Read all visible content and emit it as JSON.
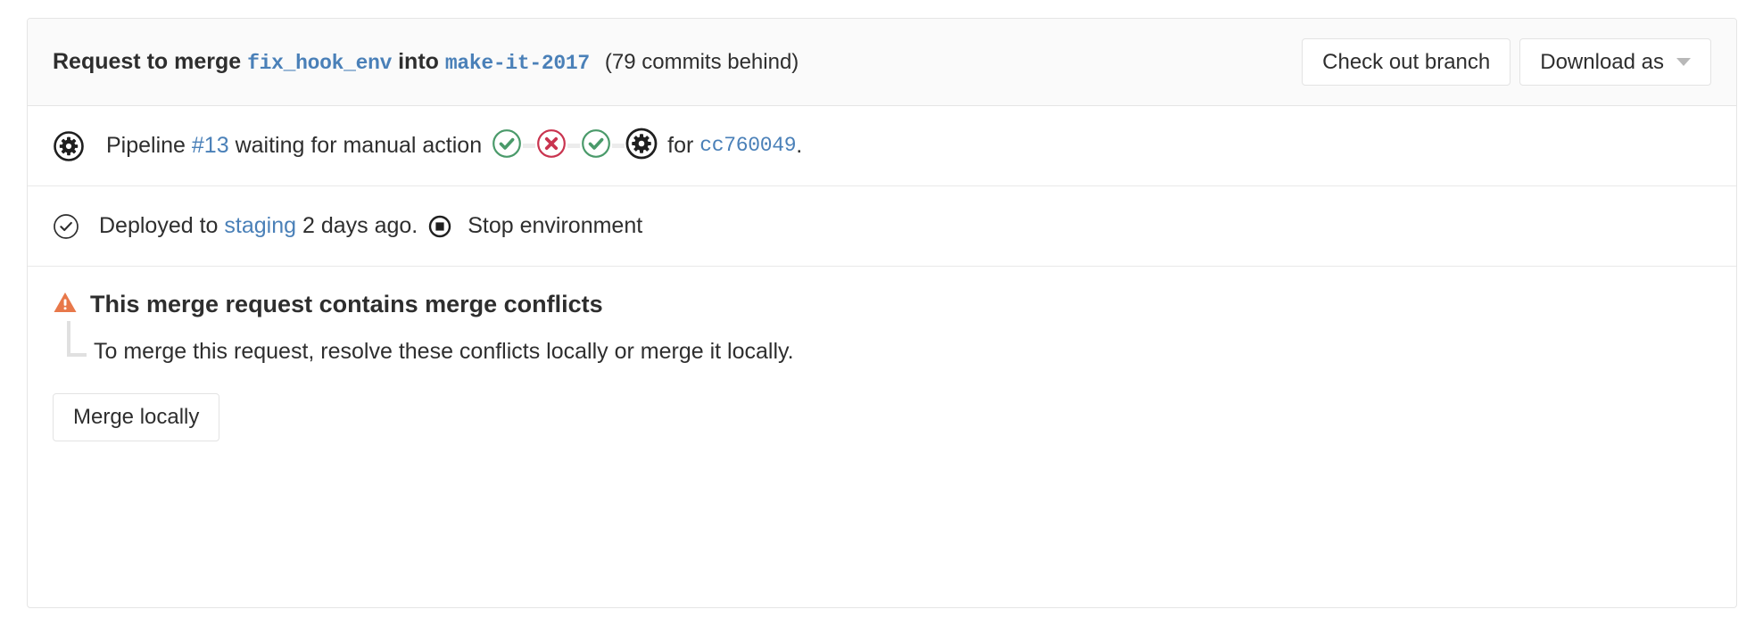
{
  "header": {
    "prefix": "Request to merge",
    "source_branch": "fix_hook_env",
    "into": "into",
    "target_branch": "make-it-2017",
    "commits_behind": "(79 commits behind)",
    "checkout_button": "Check out branch",
    "download_button": "Download as",
    "caret_icon": "chevron-down-icon"
  },
  "pipeline": {
    "status_icon": "pipeline-manual-gear-icon",
    "label": "Pipeline",
    "pipeline_id": "#13",
    "status_text": "waiting for manual action",
    "for_label": "for",
    "commit_sha": "cc760049",
    "period": ".",
    "stages": [
      {
        "name": "stage-status-success",
        "icon": "check-icon",
        "color": "#4a9a6a"
      },
      {
        "name": "stage-status-failed",
        "icon": "x-icon",
        "color": "#c9344f"
      },
      {
        "name": "stage-status-success",
        "icon": "check-icon",
        "color": "#4a9a6a"
      },
      {
        "name": "stage-status-manual",
        "icon": "gear-icon",
        "color": "#1f1f1f"
      }
    ]
  },
  "deployment": {
    "status_icon": "check-circle-icon",
    "prefix": "Deployed to",
    "environment": "staging",
    "time_ago": "2 days ago.",
    "stop_icon": "stop-environment-icon",
    "stop_label": "Stop environment"
  },
  "conflict": {
    "warning_icon": "warning-triangle-icon",
    "warning_color": "#e8784a",
    "title": "This merge request contains merge conflicts",
    "description": "To merge this request, resolve these conflicts locally or merge it locally.",
    "merge_locally_button": "Merge locally"
  },
  "colors": {
    "link": "#4a80b8",
    "success": "#4a9a6a",
    "failed": "#c9344f",
    "warning": "#e8784a",
    "border": "#e5e5e5",
    "header_bg": "#fafafa"
  }
}
